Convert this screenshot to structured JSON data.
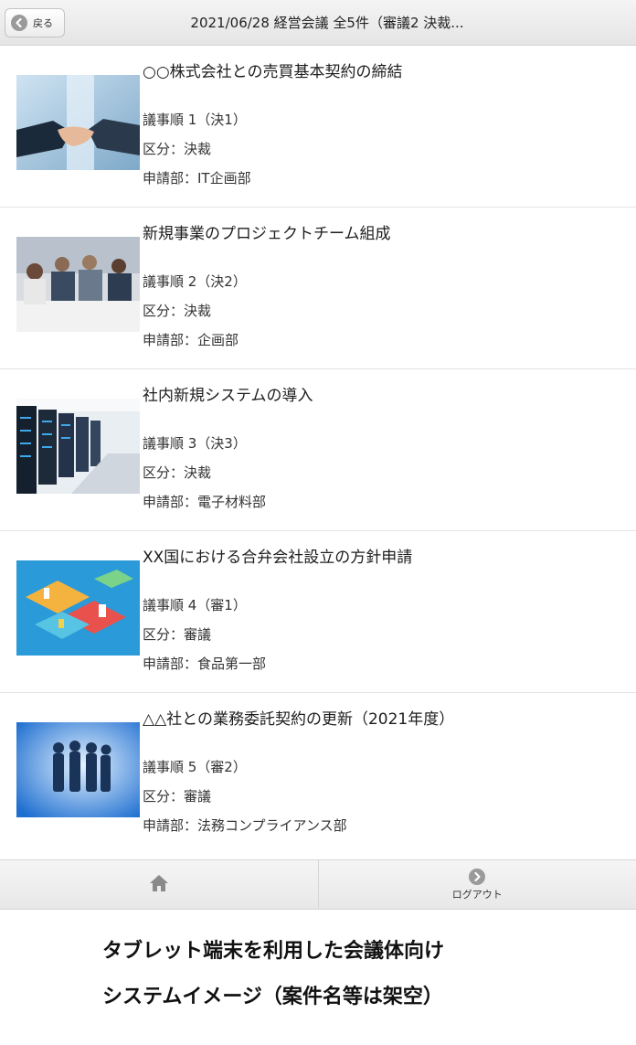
{
  "header": {
    "back_label": "戻る",
    "title": "2021/06/28 経営会議 全5件（審議2 決裁..."
  },
  "items": [
    {
      "title": "○○株式会社との売買基本契約の締結",
      "order": "議事順 1（決1）",
      "category": "区分：決裁",
      "department": "申請部：IT企画部",
      "image": "handshake-photo"
    },
    {
      "title": "新規事業のプロジェクトチーム組成",
      "order": "議事順 2（決2）",
      "category": "区分：決裁",
      "department": "申請部：企画部",
      "image": "meeting-photo"
    },
    {
      "title": "社内新規システムの導入",
      "order": "議事順 3（決3）",
      "category": "区分：決裁",
      "department": "申請部：電子材料部",
      "image": "server-room-photo"
    },
    {
      "title": "XX国における合弁会社設立の方針申請",
      "order": "議事順 4（審1）",
      "category": "区分：審議",
      "department": "申請部：食品第一部",
      "image": "isometric-office-illustration"
    },
    {
      "title": "△△社との業務委託契約の更新（2021年度）",
      "order": "議事順 5（審2）",
      "category": "区分：審議",
      "department": "申請部：法務コンプライアンス部",
      "image": "business-people-silhouette"
    }
  ],
  "footer": {
    "home_icon": "home-icon",
    "logout_label": "ログアウト"
  },
  "caption": {
    "line1": "タブレット端末を利用した会議体向け",
    "line2": "システムイメージ（案件名等は架空）"
  }
}
